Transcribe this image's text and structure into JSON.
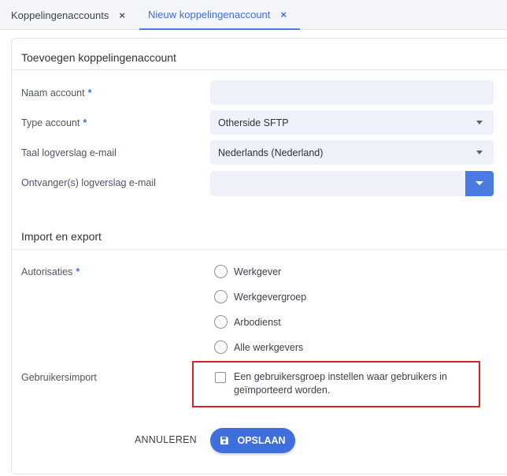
{
  "tabs": [
    {
      "label": "Koppelingenaccounts",
      "close_icon": "×"
    },
    {
      "label": "Nieuw koppelingenaccount",
      "close_icon": "×"
    }
  ],
  "form": {
    "title": "Toevoegen koppelingenaccount",
    "required_marker": "*",
    "fields": {
      "name": {
        "label": "Naam account",
        "value": ""
      },
      "type": {
        "label": "Type account",
        "value": "Otherside SFTP"
      },
      "language": {
        "label": "Taal logverslag e-mail",
        "value": "Nederlands (Nederland)"
      },
      "recipients": {
        "label": "Ontvanger(s) logverslag e-mail",
        "value": ""
      }
    }
  },
  "import_export": {
    "title": "Import en export",
    "authorizations": {
      "label": "Autorisaties",
      "options": [
        "Werkgever",
        "Werkgevergroep",
        "Arbodienst",
        "Alle werkgevers"
      ]
    },
    "user_import": {
      "label": "Gebruikersimport",
      "checkbox_text": "Een gebruikersgroep instellen waar gebruikers in geïmporteerd worden."
    }
  },
  "actions": {
    "cancel_label": "ANNULEREN",
    "save_label": "OPSLAAN"
  },
  "colors": {
    "accent": "#3f6fdc",
    "highlight": "#d9232b",
    "input_bg": "#eef0fa"
  }
}
